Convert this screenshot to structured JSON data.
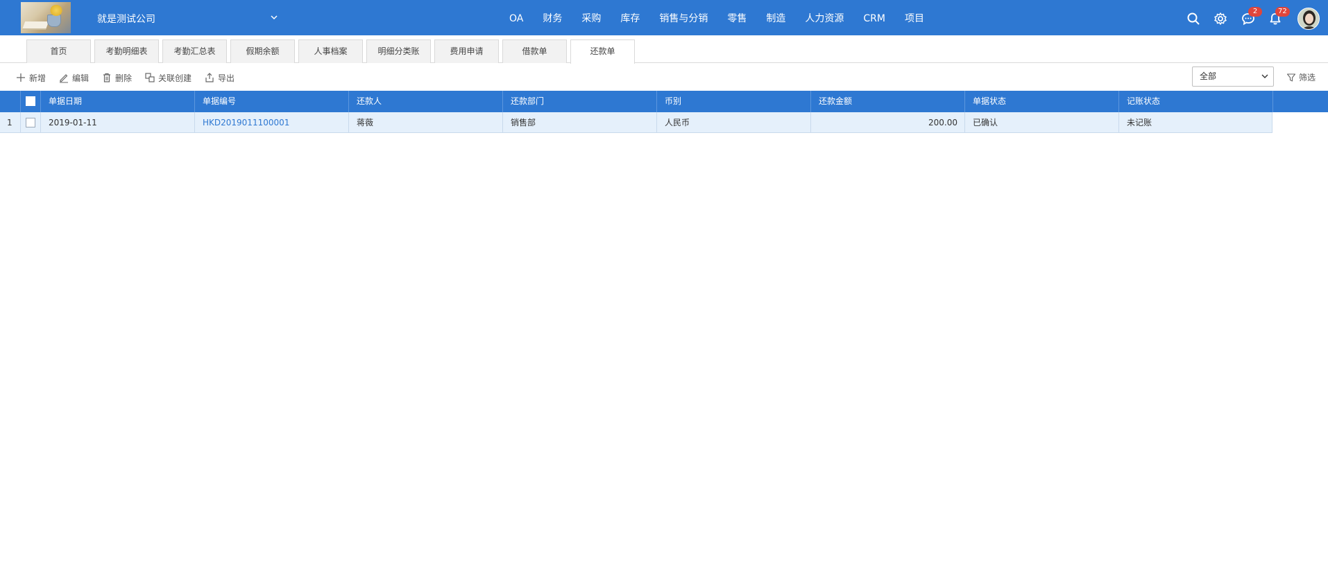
{
  "header": {
    "company": "就是测试公司",
    "nav": [
      "OA",
      "财务",
      "采购",
      "库存",
      "销售与分销",
      "零售",
      "制造",
      "人力资源",
      "CRM",
      "项目"
    ],
    "message_count": "2",
    "notification_count": "72"
  },
  "tabs": [
    "首页",
    "考勤明细表",
    "考勤汇总表",
    "假期余额",
    "人事档案",
    "明细分类账",
    "费用申请",
    "借款单",
    "还款单"
  ],
  "active_tab": "还款单",
  "toolbar": {
    "add": "新增",
    "edit": "编辑",
    "delete": "删除",
    "link_create": "关联创建",
    "export": "导出",
    "status_select": "全部",
    "filter": "筛选"
  },
  "table": {
    "columns": [
      "单据日期",
      "单据编号",
      "还款人",
      "还款部门",
      "币别",
      "还款金额",
      "单据状态",
      "记账状态"
    ],
    "rows": [
      {
        "index": "1",
        "date": "2019-01-11",
        "number": "HKD2019011100001",
        "payer": "蒋薇",
        "department": "销售部",
        "currency": "人民币",
        "amount": "200.00",
        "doc_status": "已确认",
        "posting_status": "未记账"
      }
    ]
  },
  "colors": {
    "primary": "#2e78d2",
    "row_bg": "#e5f0fb",
    "badge": "#e0453a"
  }
}
